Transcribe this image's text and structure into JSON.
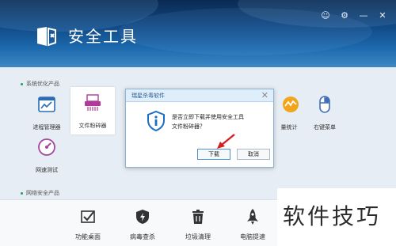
{
  "app": {
    "title": "安全工具"
  },
  "window_controls": {
    "feedback": "☺",
    "settings": "⚙",
    "minimize": "—",
    "close": "✕"
  },
  "sections": {
    "optimize": "系统优化产品",
    "network": "网络安全产品"
  },
  "tiles": [
    {
      "label": "进程管理器",
      "icon": "process-manager-icon"
    },
    {
      "label": "文件粉碎器",
      "icon": "file-shredder-icon"
    },
    {
      "label": "流量统计",
      "icon": "traffic-stats-icon"
    },
    {
      "label": "右键菜单",
      "icon": "context-menu-icon"
    },
    {
      "label": "网速测试",
      "icon": "speed-test-icon"
    }
  ],
  "partial_labels": {
    "traffic": "量统计"
  },
  "bottom_bar": [
    {
      "label": "功能桌面",
      "icon": "desktop-check-icon"
    },
    {
      "label": "病毒查杀",
      "icon": "virus-scan-icon"
    },
    {
      "label": "垃圾清理",
      "icon": "trash-icon"
    },
    {
      "label": "电脑提速",
      "icon": "rocket-icon"
    }
  ],
  "dialog": {
    "title": "瑞星杀毒软件",
    "message_line1": "是否立即下载并使用安全工具",
    "message_line2": "文件粉碎器？",
    "download_button": "下载",
    "cancel_button": "取消"
  },
  "watermark": "软件技巧",
  "colors": {
    "header_top": "#0a2a52",
    "header_bottom": "#3d88c4",
    "accent": "#1a6fc4",
    "arrow": "#d42020"
  }
}
